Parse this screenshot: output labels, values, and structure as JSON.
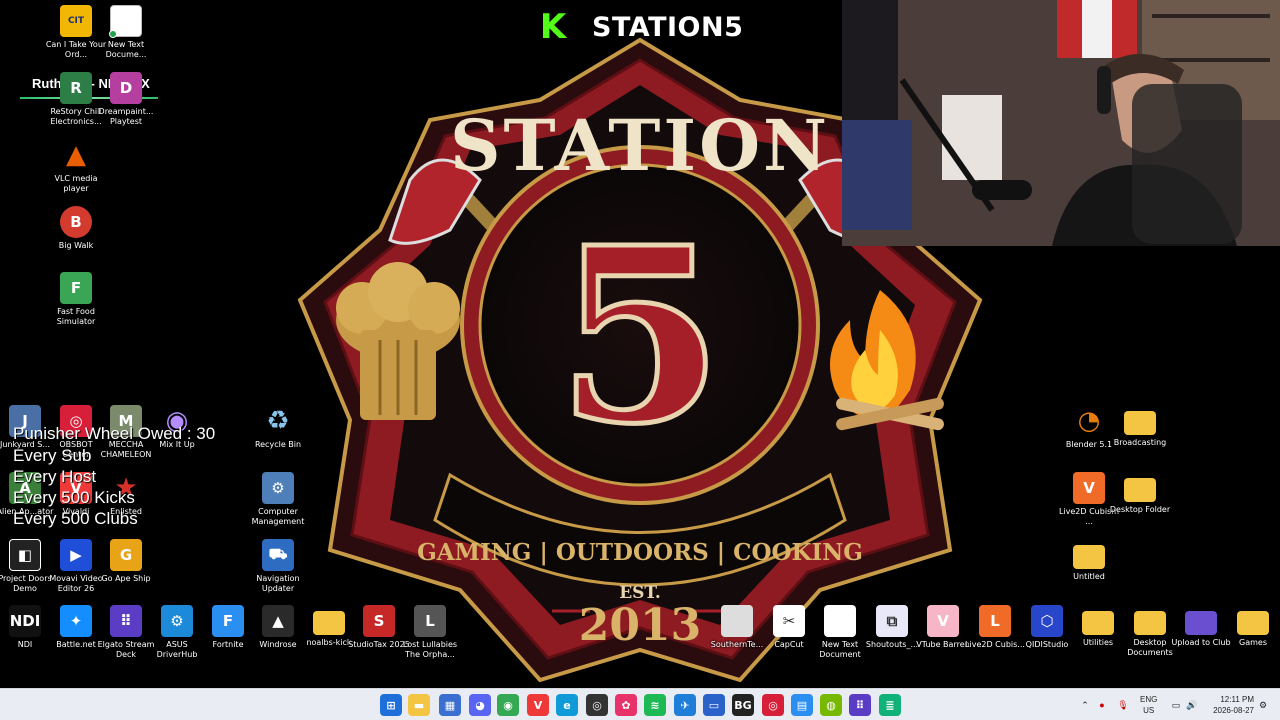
{
  "stream": {
    "brand_name": "STATION5",
    "brand_mark": "K"
  },
  "wallpaper": {
    "title": "STATION",
    "number": "5",
    "tagline": "GAMING | OUTDOORS | COOKING",
    "est_label": "EST.",
    "year": "2013"
  },
  "now_playing": "Ruthless - NEFFEX",
  "overlay_lines": [
    "Punisher Wheel Owed : 30",
    "Every Sub",
    "Every Host",
    "Every 500 Kicks",
    "Every 500 Clubs"
  ],
  "desktop": {
    "col1": [
      {
        "label": "Can I Take Your Ord...",
        "icon": "game-icon",
        "color": "#f2b705",
        "glyph": "CIT"
      },
      {
        "label": "ReStory Chill Electronics...",
        "icon": "music-icon",
        "color": "#2d7d46",
        "glyph": "R"
      },
      {
        "label": "VLC media player",
        "icon": "vlc-icon",
        "color": "#e85e00",
        "glyph": "▲"
      },
      {
        "label": "Big Walk",
        "icon": "game-icon",
        "color": "#d23b2e",
        "glyph": "B"
      },
      {
        "label": "Fast Food Simulator",
        "icon": "game-icon",
        "color": "#3aa655",
        "glyph": "F"
      }
    ],
    "col2": [
      {
        "label": "New Text Docume...",
        "icon": "text-file-icon",
        "color": "#ffffff",
        "glyph": ""
      },
      {
        "label": "Dreampaint... Playtest",
        "icon": "game-icon",
        "color": "#b53f9e",
        "glyph": "D"
      }
    ],
    "mid_rows": [
      {
        "label": "Junkyard S...",
        "icon": "game-icon",
        "color": "#4a6fa5",
        "glyph": "J"
      },
      {
        "label": "OBSBOT Center",
        "icon": "camera-icon",
        "color": "#d71f3a",
        "glyph": "◎"
      },
      {
        "label": "MECCHA CHAMELEON",
        "icon": "game-icon",
        "color": "#7a8a6b",
        "glyph": "M"
      },
      {
        "label": "Mix It Up",
        "icon": "fingerprint-icon",
        "color": "#7c4dff",
        "glyph": "◉"
      },
      {
        "label": "Recycle Bin",
        "icon": "recycle-bin-icon",
        "color": "#6aa9d8",
        "glyph": "♻"
      },
      {
        "label": "Alien Ap...ator",
        "icon": "game-icon",
        "color": "#3a7f3a",
        "glyph": "A"
      },
      {
        "label": "Vivaldi",
        "icon": "vivaldi-icon",
        "color": "#ef3939",
        "glyph": "V"
      },
      {
        "label": "Enlisted",
        "icon": "game-icon",
        "color": "#b32424",
        "glyph": "★"
      },
      {
        "label": "Computer Management",
        "icon": "computer-icon",
        "color": "#4e7fb8",
        "glyph": "⚙"
      },
      {
        "label": "Project Doors Demo",
        "icon": "game-icon",
        "color": "#222222",
        "glyph": "◧"
      },
      {
        "label": "Movavi Video Editor 26",
        "icon": "video-editor-icon",
        "color": "#1f4fd8",
        "glyph": "▶"
      },
      {
        "label": "Go Ape Ship",
        "icon": "game-icon",
        "color": "#e8a317",
        "glyph": "G"
      },
      {
        "label": "Navigation Updater",
        "icon": "car-icon",
        "color": "#2d6cc0",
        "glyph": "⛟"
      }
    ],
    "right_icons": [
      {
        "label": "Blender 5.1",
        "icon": "blender-icon",
        "color": "#e87d0d",
        "glyph": "◔"
      },
      {
        "label": "Broadcasting",
        "icon": "folder-icon",
        "color": "#f4c542",
        "glyph": ""
      },
      {
        "label": "Live2D Cubism ...",
        "icon": "live2d-icon",
        "color": "#f06a28",
        "glyph": "V"
      },
      {
        "label": "Desktop Folder",
        "icon": "folder-icon",
        "color": "#f4c542",
        "glyph": ""
      },
      {
        "label": "Untitled",
        "icon": "folder-icon",
        "color": "#f4c542",
        "glyph": ""
      }
    ],
    "bottom_row": [
      {
        "label": "NDI",
        "icon": "ndi-icon",
        "color": "#111111",
        "glyph": "NDI"
      },
      {
        "label": "Battle.net",
        "icon": "battlenet-icon",
        "color": "#148eff",
        "glyph": "✦"
      },
      {
        "label": "Elgato Stream Deck",
        "icon": "stream-deck-icon",
        "color": "#5b3cc4",
        "glyph": "⠿"
      },
      {
        "label": "ASUS DriverHub",
        "icon": "gear-icon",
        "color": "#1c8ad8",
        "glyph": "⚙"
      },
      {
        "label": "Fortnite",
        "icon": "fortnite-icon",
        "color": "#2a8ff0",
        "glyph": "F"
      },
      {
        "label": "Windrose",
        "icon": "game-icon",
        "color": "#2a2a2a",
        "glyph": "▲"
      },
      {
        "label": "noalbs-kick",
        "icon": "folder-icon",
        "color": "#f4c542",
        "glyph": ""
      },
      {
        "label": "StudioTax 2025",
        "icon": "tax-icon",
        "color": "#c62828",
        "glyph": "S"
      },
      {
        "label": "Lost Lullabies The Orpha...",
        "icon": "game-icon",
        "color": "#555555",
        "glyph": "L"
      },
      {
        "label": "SouthernTe...",
        "icon": "text-file-icon",
        "color": "#dddddd",
        "glyph": ""
      },
      {
        "label": "CapCut",
        "icon": "capcut-icon",
        "color": "#ffffff",
        "glyph": "✂"
      },
      {
        "label": "New Text Document",
        "icon": "text-file-icon",
        "color": "#ffffff",
        "glyph": ""
      },
      {
        "label": "Shoutouts_...",
        "icon": "link-icon",
        "color": "#e8e8f8",
        "glyph": "⧉"
      },
      {
        "label": "VTube Barren",
        "icon": "game-icon",
        "color": "#f6b6c8",
        "glyph": "V"
      },
      {
        "label": "Live2D Cubis...",
        "icon": "live2d-icon",
        "color": "#f06a28",
        "glyph": "L"
      },
      {
        "label": "QIDIStudio",
        "icon": "printer-icon",
        "color": "#2846c9",
        "glyph": "⬡"
      },
      {
        "label": "Utilities",
        "icon": "folder-icon",
        "color": "#f4c542",
        "glyph": ""
      },
      {
        "label": "Desktop Documents",
        "icon": "folder-icon",
        "color": "#f4c542",
        "glyph": ""
      },
      {
        "label": "Upload to Club",
        "icon": "folder-icon",
        "color": "#6a4fd0",
        "glyph": ""
      },
      {
        "label": "Games",
        "icon": "folder-icon",
        "color": "#f4c542",
        "glyph": ""
      }
    ]
  },
  "taskbar": {
    "apps": [
      {
        "name": "start-button",
        "color": "#1e6fd9",
        "glyph": "⊞"
      },
      {
        "name": "file-explorer",
        "color": "#f4c542",
        "glyph": "▬"
      },
      {
        "name": "store",
        "color": "#3a6fd0",
        "glyph": "▦"
      },
      {
        "name": "discord",
        "color": "#5865f2",
        "glyph": "◕"
      },
      {
        "name": "chrome",
        "color": "#34a853",
        "glyph": "◉"
      },
      {
        "name": "vivaldi",
        "color": "#ef3939",
        "glyph": "V"
      },
      {
        "name": "edge",
        "color": "#0f9bd7",
        "glyph": "e"
      },
      {
        "name": "obs",
        "color": "#333333",
        "glyph": "◎"
      },
      {
        "name": "app-pink",
        "color": "#e8336a",
        "glyph": "✿"
      },
      {
        "name": "spotify",
        "color": "#1db954",
        "glyph": "≋"
      },
      {
        "name": "app-blue",
        "color": "#1f7ed8",
        "glyph": "✈"
      },
      {
        "name": "app-window",
        "color": "#2a62c9",
        "glyph": "▭"
      },
      {
        "name": "app-bg",
        "color": "#222222",
        "glyph": "BG"
      },
      {
        "name": "obsbot",
        "color": "#d71f3a",
        "glyph": "◎"
      },
      {
        "name": "app-chat",
        "color": "#2a8ff0",
        "glyph": "▤"
      },
      {
        "name": "app-gpu",
        "color": "#76b900",
        "glyph": "◍"
      },
      {
        "name": "stream-deck",
        "color": "#5b3cc4",
        "glyph": "⠿"
      },
      {
        "name": "app-audio",
        "color": "#10b27a",
        "glyph": "≣"
      }
    ],
    "lang_top": "ENG",
    "lang_bottom": "US",
    "time": "12:11 PM",
    "date": "2026-08-27"
  }
}
